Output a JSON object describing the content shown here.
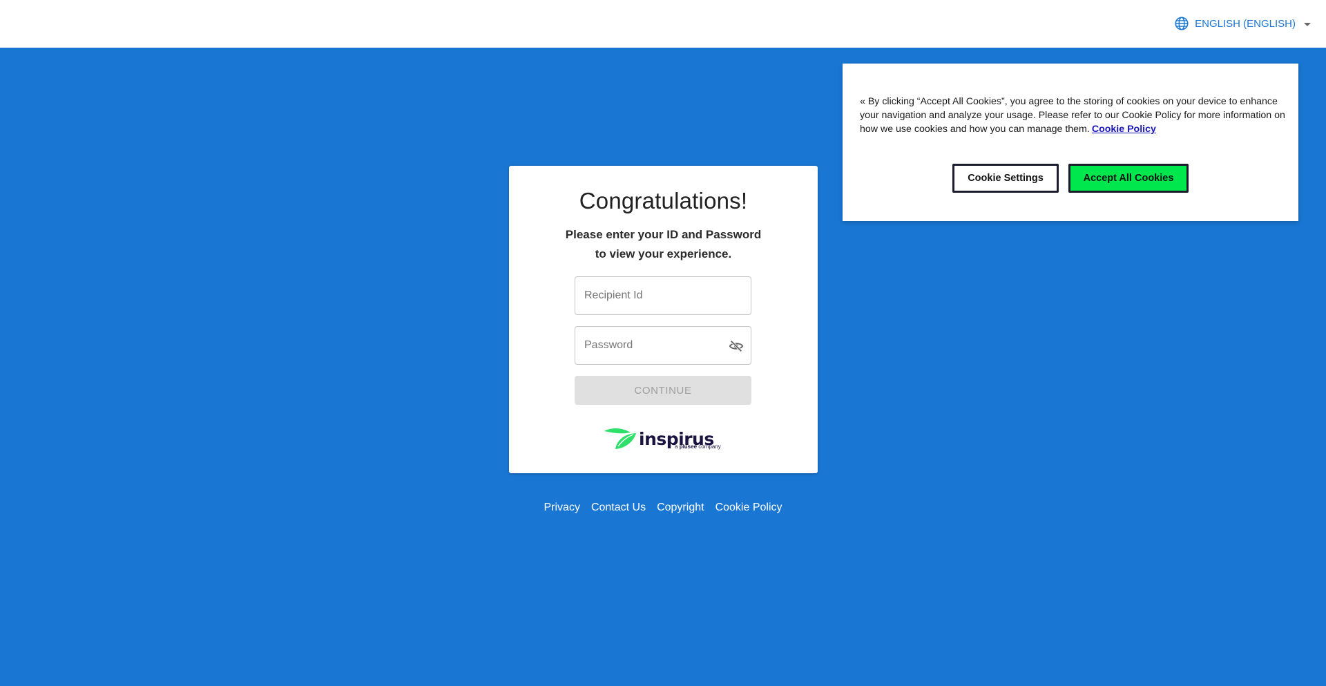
{
  "header": {
    "language_label": "ENGLISH (ENGLISH)"
  },
  "login": {
    "title": "Congratulations!",
    "subtitle": "Please enter your ID and Password to view your experience.",
    "recipient_placeholder": "Recipient Id",
    "password_placeholder": "Password",
    "continue_label": "CONTINUE"
  },
  "logo": {
    "word": "inspirus",
    "tag_prefix": "a",
    "tag_brand": "plusee",
    "tag_suffix": "company"
  },
  "footer": {
    "links": [
      "Privacy",
      "Contact Us",
      "Copyright",
      "Cookie Policy"
    ]
  },
  "cookie_banner": {
    "text": "« By clicking “Accept All Cookies”, you agree to the storing of cookies on your device to enhance your navigation and analyze your usage. Please refer to our Cookie Policy for more information on how we use cookies and how you can manage them.",
    "policy_link": "Cookie Policy",
    "settings_label": "Cookie Settings",
    "accept_label": "Accept All Cookies"
  },
  "colors": {
    "background": "#1976d2",
    "accent": "#1976d2",
    "accept_button": "#00e64d",
    "logo_leaf": "#2ee06a",
    "logo_text": "#1b1340"
  },
  "icons": {
    "language": "globe-icon",
    "dropdown": "caret-down-icon",
    "password_toggle": "eye-off-icon",
    "logo_mark": "leaf-icon"
  }
}
